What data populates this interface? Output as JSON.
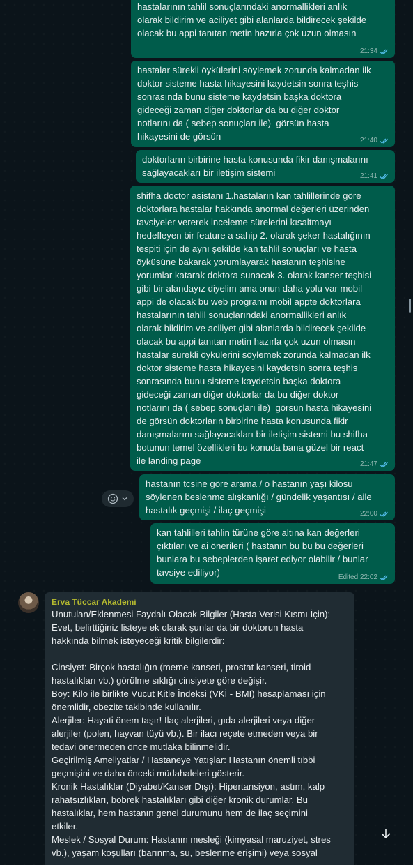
{
  "messages": [
    {
      "text": "hastalarının tahlil sonuçlarındaki anormallikleri anlık\nolarak bildirim ve aciliyet gibi alanlarda bildirecek şekilde\nolacak bu appi tanıtan metin hazırla çok uzun olmasın",
      "time": "21:34"
    },
    {
      "text": "hastalar sürekli öykülerini söylemek zorunda kalmadan ilk\ndoktor sisteme hasta hikayesini kaydetsin sonra teşhis\nsonrasında bunu sisteme kaydetsin başka doktora\ngideceği zaman diğer doktorlar da bu diğer doktor\nnotlarını da ( sebep sonuçları ile)  görsün hasta\nhikayesini de görsün",
      "time": "21:40"
    },
    {
      "text": "doktorların birbirine hasta konusunda fikir danışmalarını\nsağlayacakları bir iletişim sistemi",
      "time": "21:41"
    },
    {
      "text": "shifha doctor asistanı 1.hastaların kan tahlillerinde göre\ndoktorlara hastalar hakkında anormal değerleri üzerinden\ntavsiyeler vererek inceleme sürelerini kısaltmayı\nhedefleyen bir feature a sahip 2. olarak şeker hastalığının\ntespiti için de aynı şekilde kan tahlil sonuçları ve hasta\nöyküsüne bakarak yorumlayarak hastanın teşhisine\nyorumlar katarak doktora sunacak 3. olarak kanser teşhisi\ngibi bir alandayız diyelim ama onun daha yolu var mobil\nappi de olacak bu web programı mobil appte doktorlara\nhastalarının tahlil sonuçlarındaki anormallikleri anlık\nolarak bildirim ve aciliyet gibi alanlarda bildirecek şekilde\nolacak bu appi tanıtan metin hazırla çok uzun olmasın\nhastalar sürekli öykülerini söylemek zorunda kalmadan ilk\ndoktor sisteme hasta hikayesini kaydetsin sonra teşhis\nsonrasında bunu sisteme kaydetsin başka doktora\ngideceği zaman diğer doktorlar da bu diğer doktor\nnotlarını da ( sebep sonuçları ile)  görsün hasta hikayesini\nde görsün doktorların birbirine hasta konusunda fikir\ndanışmalarını sağlayacakları bir iletişim sistemi bu shifha\nbotunun temel özellikleri bu konuda bana güzel bir react\nile landing page",
      "time": "21:47"
    },
    {
      "text": "hastanın tcsine göre arama / o hastanın yaşı kilosu\nsöylenen beslenme alışkanlığı / gündelik yaşantısı / aile\nhastalık geçmişi / ilaç geçmişi",
      "time": "22:00"
    },
    {
      "text": "kan tahlilleri tahlin türüne göre altına kan değerleri\nçıktıları ve ai önerileri ( hastanın bu bu bu değerleri\nbunlara bu sebeplerden işaret ediyor olabilir / bunlar\ntavsiye ediliyor)",
      "time": "Edited 22:02"
    }
  ],
  "incoming": {
    "sender": "Erva Tüccar Akademi",
    "text": "Unutulan/Eklenmesi Faydalı Olacak Bilgiler (Hasta Verisi Kısmı İçin):\nEvet, belirttiğiniz listeye ek olarak şunlar da bir doktorun hasta\nhakkında bilmek isteyeceği kritik bilgilerdir:\n\nCinsiyet: Birçok hastalığın (meme kanseri, prostat kanseri, tiroid\nhastalıkları vb.) görülme sıklığı cinsiyete göre değişir.\nBoy: Kilo ile birlikte Vücut Kitle İndeksi (VKİ - BMI) hesaplaması için\nönemlidir, obezite takibinde kullanılır.\nAlerjiler: Hayati önem taşır! İlaç alerjileri, gıda alerjileri veya diğer\nalerjiler (polen, hayvan tüyü vb.). Bir ilacı reçete etmeden veya bir\ntedavi önermeden önce mutlaka bilinmelidir.\nGeçirilmiş Ameliyatlar / Hastaneye Yatışlar: Hastanın önemli tıbbi\ngeçmişini ve daha önceki müdahaleleri gösterir.\nKronik Hastalıklar (Diyabet/Kanser Dışı): Hipertansiyon, astım, kalp\nrahatsızlıkları, böbrek hastalıkları gibi diğer kronik durumlar. Bu\nhastalıklar, hem hastanın genel durumunu hem de ilaç seçimini\netkiler.\nMeslek / Sosyal Durum: Hastanın mesleği (kimyasal maruziyet, stres\nvb.), yaşam koşulları (barınma, su, beslenme erişimi) veya sosyal"
  },
  "colors": {
    "background": "#0b141a",
    "outgoing_bubble": "#005c4b",
    "incoming_bubble": "#202c33",
    "sender_name": "#b5ba2f",
    "read_ticks": "#53bdeb"
  },
  "icons": {
    "read": "double-check-icon",
    "react": "emoji-smile-icon",
    "scroll": "arrow-down-icon"
  }
}
